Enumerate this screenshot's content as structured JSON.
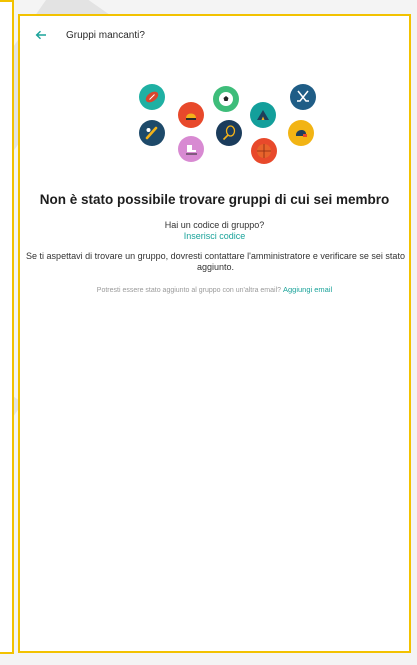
{
  "header": {
    "title": "Gruppi mancanti?"
  },
  "empty_state": {
    "heading": "Non è stato possibile trovare gruppi di cui sei membro",
    "code_question": "Hai un codice di gruppo?",
    "code_link": "Inserisci codice",
    "info": "Se ti aspettavi di trovare un gruppo, dovresti contattare l'amministratore e verificare se sei stato aggiunto.",
    "email_question": "Potresti essere stato aggiunto al gruppo con un'altra email?",
    "email_link": "Aggiungi email"
  },
  "colors": {
    "accent": "#1aa39a",
    "frame": "#f2c200"
  },
  "sport_icons": [
    "football-icon",
    "hockey-helmet-icon",
    "soccer-ball-icon",
    "camping-tent-icon",
    "hockey-sticks-icon",
    "baseball-icon",
    "tennis-icon",
    "ice-skate-icon",
    "basketball-icon",
    "american-football-helmet-icon"
  ]
}
